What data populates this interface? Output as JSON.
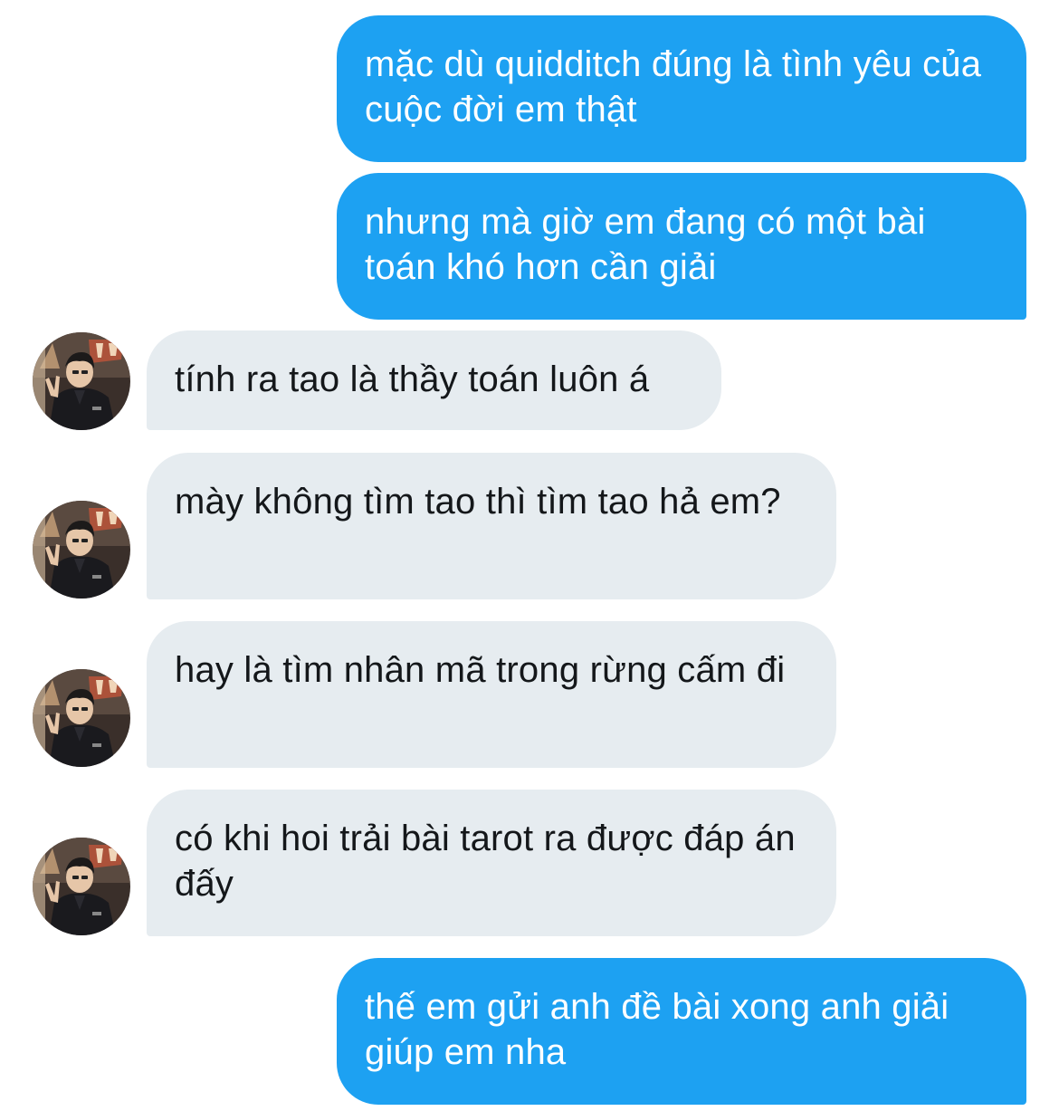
{
  "conversation": {
    "messages": [
      {
        "sender": "me",
        "text": "mặc dù quidditch đúng là tình yêu của cuộc đời em thật"
      },
      {
        "sender": "me",
        "text": "nhưng mà giờ em đang có một bài toán khó hơn cần giải"
      },
      {
        "sender": "other",
        "text": "tính ra tao là thầy toán luôn á"
      },
      {
        "sender": "other",
        "text": "mày không tìm tao thì tìm tao hả em?"
      },
      {
        "sender": "other",
        "text": "hay là tìm nhân mã trong rừng cấm đi"
      },
      {
        "sender": "other",
        "text": "có khi hoi trải bài tarot ra được đáp án đấy"
      },
      {
        "sender": "me",
        "text": "thế em gửi anh đề bài xong anh giải giúp em nha"
      }
    ]
  },
  "colors": {
    "sent_bubble": "#1da1f2",
    "received_bubble": "#e6ecf0",
    "sent_text": "#ffffff",
    "received_text": "#14171a"
  },
  "icons": {
    "avatar": "user-avatar-photo"
  }
}
